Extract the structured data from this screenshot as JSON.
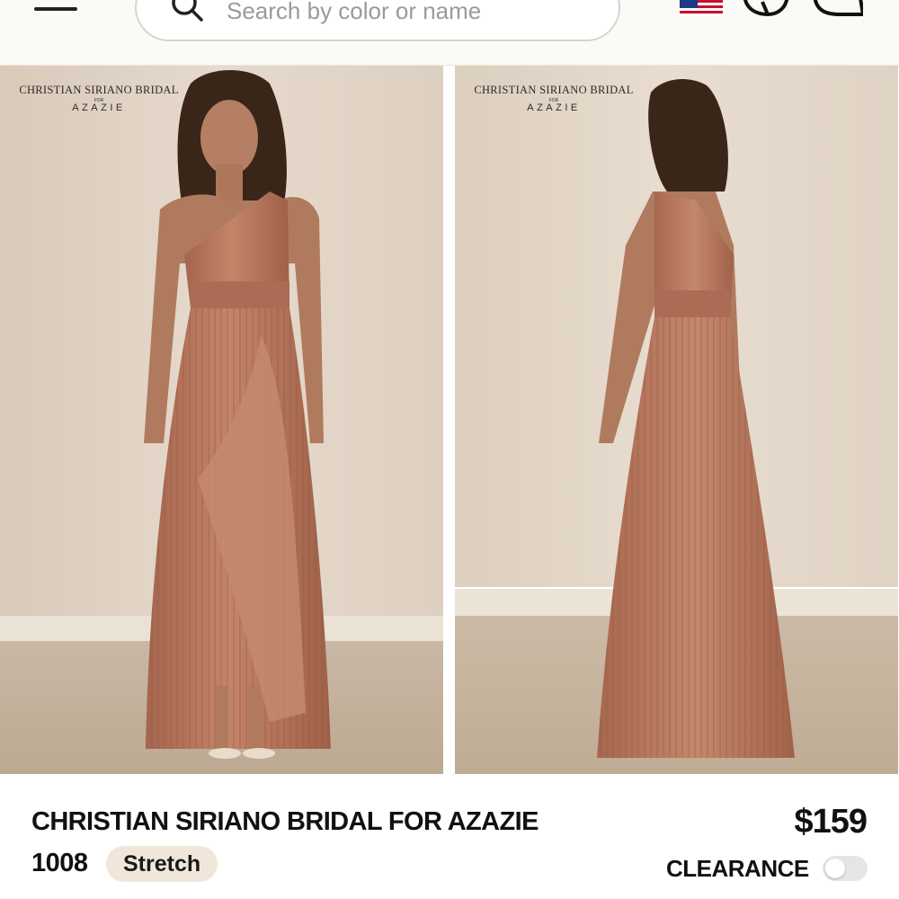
{
  "header": {
    "search": {
      "placeholder": "Search by color or name"
    },
    "icons": [
      "menu-icon",
      "search-icon",
      "us-flag-icon",
      "chat-icon",
      "cart-icon"
    ]
  },
  "gallery": {
    "images": [
      {
        "brand_line1": "CHRISTIAN SIRIANO BRIDAL",
        "brand_for": "FOR",
        "brand_line2": "AZAZIE"
      },
      {
        "brand_line1": "CHRISTIAN SIRIANO BRIDAL",
        "brand_for": "FOR",
        "brand_line2": "AZAZIE"
      }
    ]
  },
  "product": {
    "title": "CHRISTIAN SIRIANO BRIDAL FOR AZAZIE",
    "price": "$159",
    "style_number": "1008",
    "badge": "Stretch",
    "clearance_label": "CLEARANCE",
    "clearance_on": false
  },
  "colors": {
    "dress": "#b9785f",
    "wall": "#e2d5c6",
    "floor": "#cdbeaa",
    "badge_bg": "#f1e6da",
    "text": "#111111"
  }
}
